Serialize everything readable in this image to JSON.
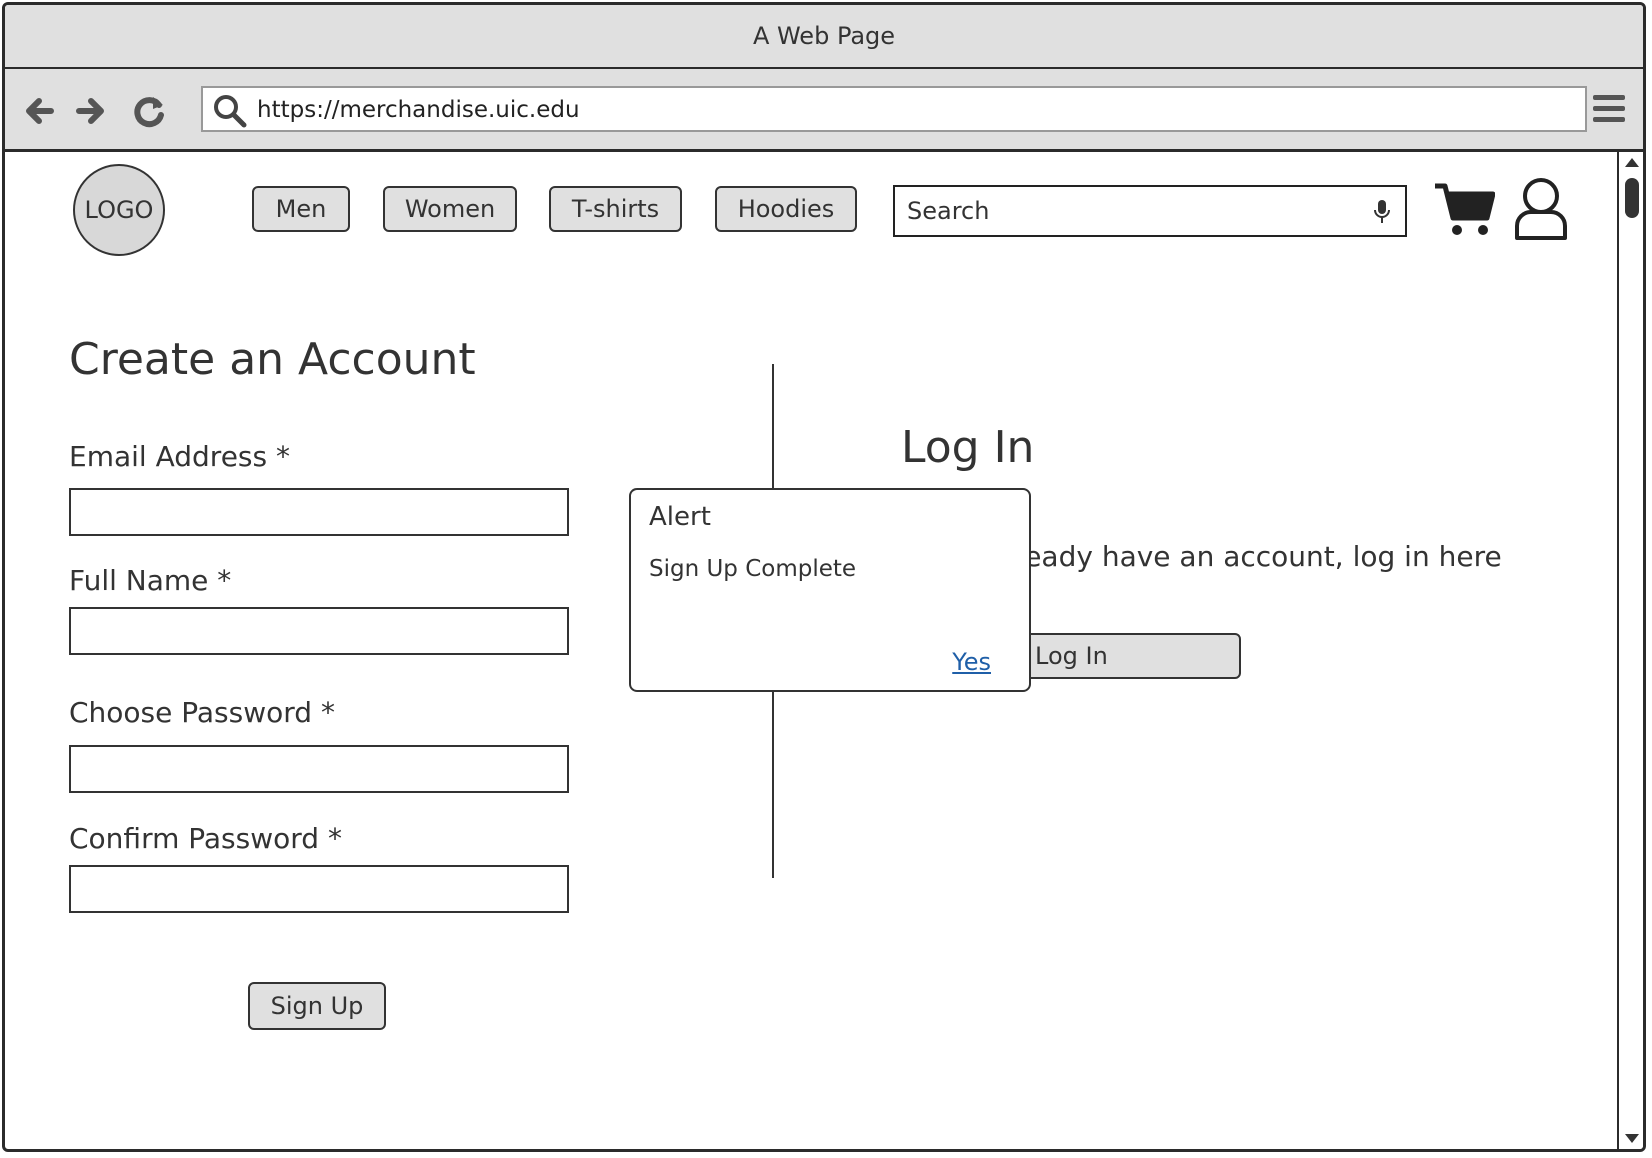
{
  "window": {
    "title": "A Web Page"
  },
  "browser": {
    "url": "https://merchandise.uic.edu"
  },
  "header": {
    "logo": "LOGO",
    "nav": [
      "Men",
      "Women",
      "T-shirts",
      "Hoodies"
    ],
    "search_placeholder": "Search"
  },
  "signup": {
    "title": "Create an Account",
    "email_label": "Email Address *",
    "name_label": "Full Name *",
    "password_label": "Choose Password *",
    "confirm_label": "Confirm Password *",
    "submit_label": "Sign Up"
  },
  "login": {
    "title": "Log In",
    "prompt": "If you already have an account, log in here",
    "button_label": "Log In"
  },
  "alert": {
    "title": "Alert",
    "message": "Sign Up Complete",
    "confirm_link": "Yes"
  },
  "icons": {
    "back": "arrow-left-icon",
    "forward": "arrow-right-icon",
    "reload": "reload-icon",
    "search": "search-icon",
    "menu": "hamburger-menu-icon",
    "mic": "microphone-icon",
    "cart": "shopping-cart-icon",
    "user": "user-icon"
  }
}
